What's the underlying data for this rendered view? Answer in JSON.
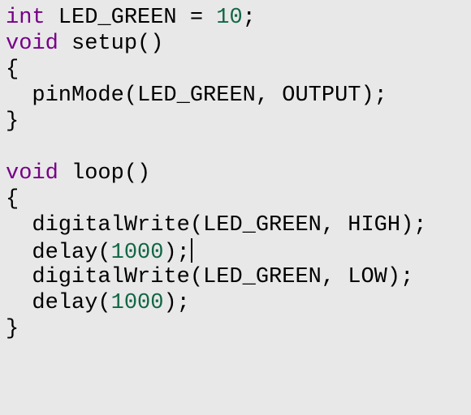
{
  "colors": {
    "background": "#e8e8e8",
    "keyword": "#770088",
    "number": "#116644",
    "text": "#000000"
  },
  "editor": {
    "lines": [
      {
        "kw": "int",
        "text": " LED_GREEN = ",
        "num": "10",
        "tail": ";"
      },
      {
        "kw": "void",
        "text": " setup()"
      },
      {
        "text": "{"
      },
      {
        "text": "  pinMode(LED_GREEN, OUTPUT);"
      },
      {
        "text": "}"
      },
      {
        "text": ""
      },
      {
        "kw": "void",
        "text": " loop()"
      },
      {
        "text": "{"
      },
      {
        "text": "  digitalWrite(LED_GREEN, HIGH);"
      },
      {
        "text": "  delay(",
        "num": "1000",
        "tail": ");"
      },
      {
        "text": "  digitalWrite(LED_GREEN, LOW);"
      },
      {
        "text": "  delay(",
        "num": "1000",
        "tail": ");"
      },
      {
        "text": "}"
      }
    ]
  }
}
